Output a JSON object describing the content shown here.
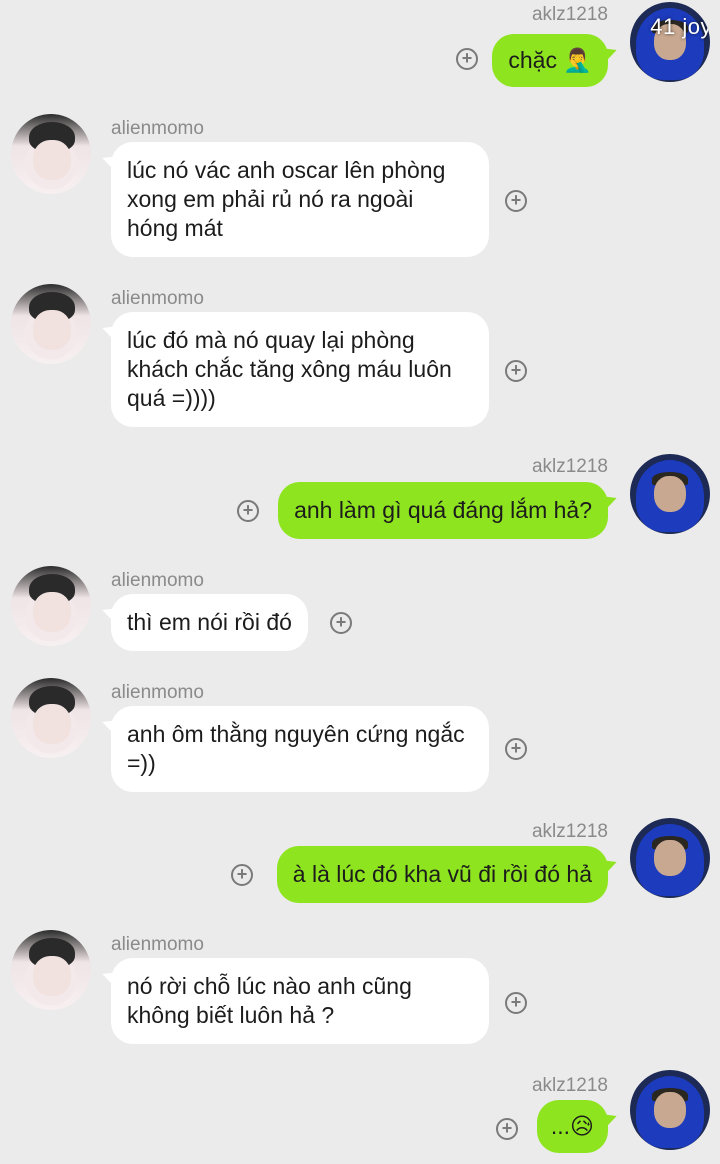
{
  "users": {
    "self": "aklz1218",
    "other": "alienmomo"
  },
  "avatar_overlay_text": "41 joy",
  "messages": [
    {
      "from": "aklz1218",
      "lines": [
        "chặc 🤦‍♂️"
      ]
    },
    {
      "from": "alienmomo",
      "lines": [
        "lúc nó vác anh oscar lên phòng",
        "xong em phải rủ nó ra ngoài",
        "hóng mát"
      ]
    },
    {
      "from": "alienmomo",
      "lines": [
        "lúc đó mà nó quay lại phòng",
        "khách chắc tăng xông máu luôn",
        "quá =))))"
      ]
    },
    {
      "from": "aklz1218",
      "lines": [
        "anh làm gì quá đáng lắm hả?"
      ]
    },
    {
      "from": "alienmomo",
      "lines": [
        "thì em nói rồi đó"
      ]
    },
    {
      "from": "alienmomo",
      "lines": [
        "anh ôm thằng nguyên cứng ngắc",
        "=))"
      ]
    },
    {
      "from": "aklz1218",
      "lines": [
        "à là lúc đó kha vũ đi rồi đó hả"
      ]
    },
    {
      "from": "alienmomo",
      "lines": [
        "nó rời chỗ lúc nào anh cũng",
        "không biết luôn hả ?"
      ]
    },
    {
      "from": "aklz1218",
      "lines": [
        "...😥"
      ]
    }
  ],
  "icons": {
    "reaction": "add-reaction-icon",
    "avatar_other": "alienmomo-avatar",
    "avatar_self": "aklz1218-avatar"
  },
  "colors": {
    "background": "#ebebeb",
    "outgoing_bubble": "#8ee41e",
    "incoming_bubble": "#ffffff",
    "name_text": "#8a8a8a"
  }
}
